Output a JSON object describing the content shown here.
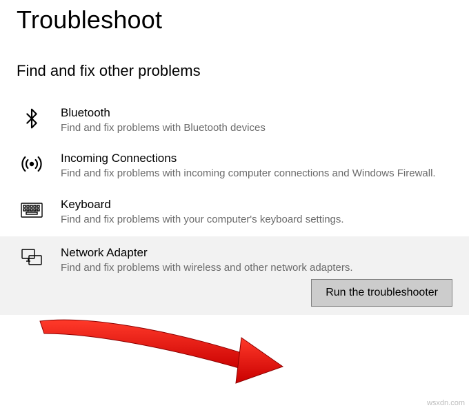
{
  "header": {
    "title": "Troubleshoot"
  },
  "section": {
    "heading": "Find and fix other problems"
  },
  "items": [
    {
      "title": "Bluetooth",
      "desc": "Find and fix problems with Bluetooth devices"
    },
    {
      "title": "Incoming Connections",
      "desc": "Find and fix problems with incoming computer connections and Windows Firewall."
    },
    {
      "title": "Keyboard",
      "desc": "Find and fix problems with your computer's keyboard settings."
    },
    {
      "title": "Network Adapter",
      "desc": "Find and fix problems with wireless and other network adapters."
    }
  ],
  "action": {
    "run_label": "Run the troubleshooter"
  },
  "watermark": "wsxdn.com"
}
